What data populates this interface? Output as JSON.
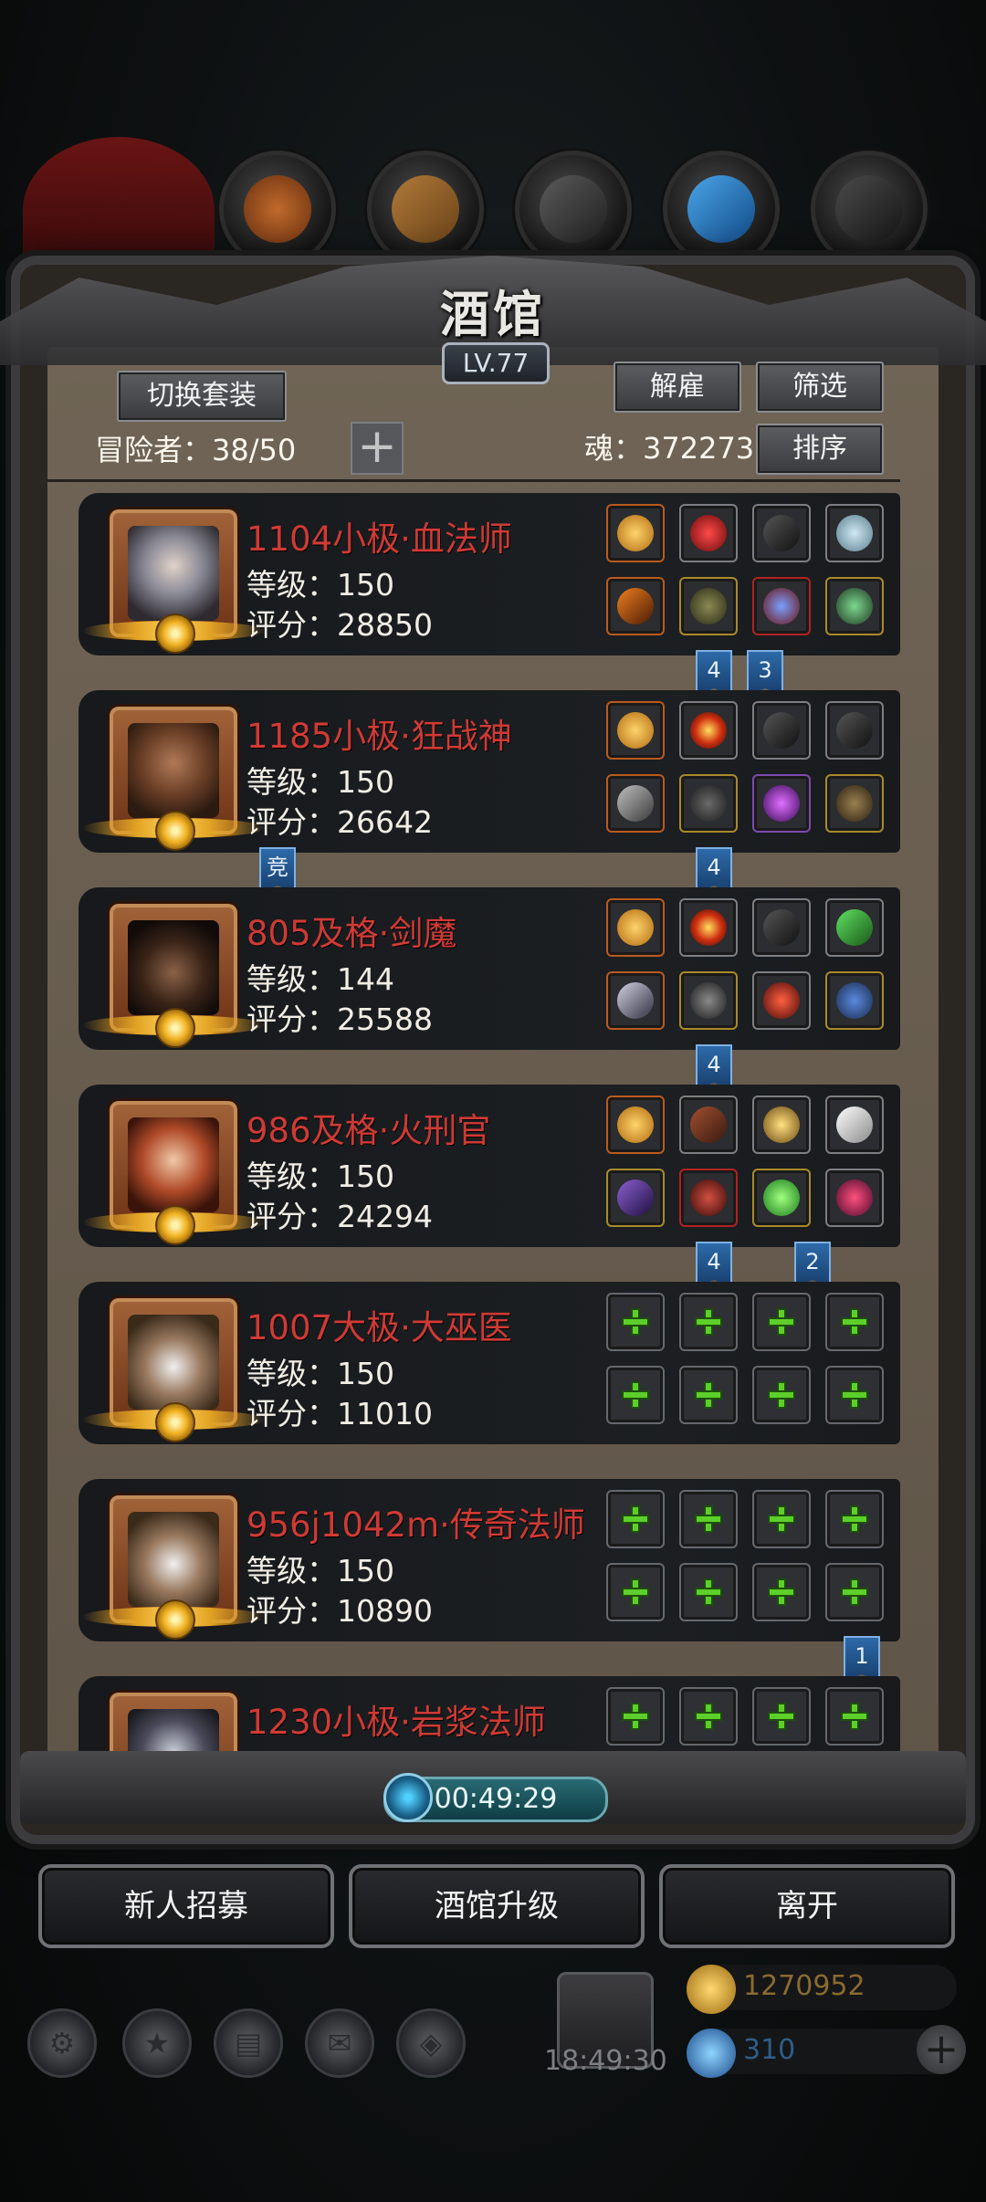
{
  "window": {
    "title": "酒馆",
    "level": "LV.77"
  },
  "toolbar": {
    "switch_outfit": "切换套装",
    "dismiss": "解雇",
    "filter": "筛选",
    "sort": "排序"
  },
  "stats": {
    "adventurers": "冒险者：38/50",
    "soul": "魂：372273"
  },
  "heroes": [
    {
      "name": "1104小极·血法师",
      "level": "等级：150",
      "score": "评分：28850",
      "flags": [
        {
          "slot": 1,
          "text": "4"
        },
        {
          "slot": 2,
          "text": "3"
        }
      ]
    },
    {
      "name": "1185小极·狂战神",
      "level": "等级：150",
      "score": "评分：26642",
      "left_flag": "竞",
      "flags": [
        {
          "slot": 1,
          "text": "4"
        }
      ]
    },
    {
      "name": "805及格·剑魔",
      "level": "等级：144",
      "score": "评分：25588",
      "flags": [
        {
          "slot": 1,
          "text": "4"
        }
      ]
    },
    {
      "name": "986及格·火刑官",
      "level": "等级：150",
      "score": "评分：24294",
      "flags": [
        {
          "slot": 1,
          "text": "4"
        },
        {
          "slot": 3,
          "text": "2"
        }
      ]
    },
    {
      "name": "1007大极·大巫医",
      "level": "等级：150",
      "score": "评分：11010",
      "flags": []
    },
    {
      "name": "956j1042m·传奇法师",
      "level": "等级：150",
      "score": "评分：10890",
      "flags": [
        {
          "slot": 4,
          "text": "1"
        }
      ]
    },
    {
      "name": "1230小极·岩浆法师",
      "level": "",
      "score": "",
      "flags": []
    }
  ],
  "timer": "00:49:29",
  "bottom_buttons": {
    "recruit": "新人招募",
    "upgrade": "酒馆升级",
    "leave": "离开"
  },
  "resources": {
    "gold": "1270952",
    "gems": "310",
    "gift_time": "18:49:30"
  },
  "icons": [
    "gear-icon",
    "star-icon",
    "scroll-icon",
    "mail-icon",
    "gift-box-icon"
  ],
  "colors": {
    "hero_name": "#d03a34",
    "accent_plus": "#5dcf2a",
    "flag_blue": "#2d6aa8"
  }
}
